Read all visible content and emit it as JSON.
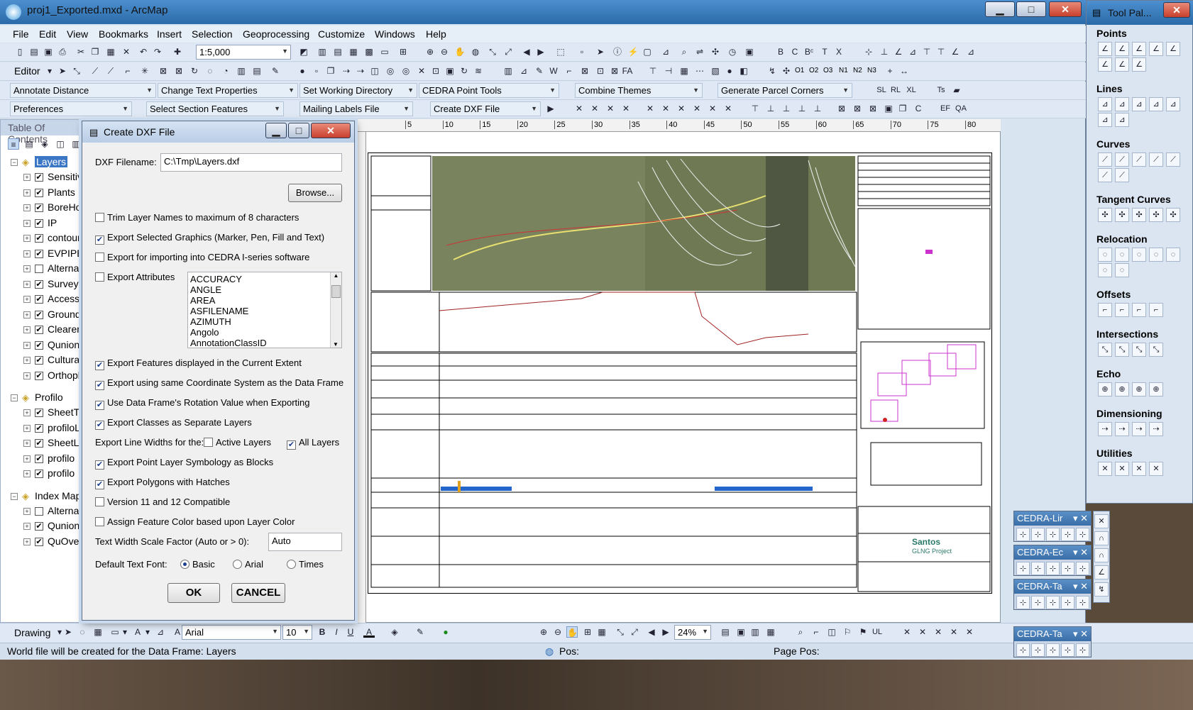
{
  "window": {
    "title": "proj1_Exported.mxd - ArcMap",
    "min": "▁",
    "max": "□",
    "close": "✕"
  },
  "menu": [
    "File",
    "Edit",
    "View",
    "Bookmarks",
    "Insert",
    "Selection",
    "Geoprocessing",
    "Customize",
    "Windows",
    "Help"
  ],
  "toolbar": {
    "scale": "1:5,000",
    "editor_label": "Editor",
    "dropdowns_row3": [
      "Annotate Distance",
      "Change Text Properties",
      "Set Working Directory",
      "CEDRA Point Tools",
      "Combine Themes",
      "Generate Parcel Corners"
    ],
    "dropdowns_row4": [
      "Preferences",
      "Select Section Features",
      "Mailing Labels File",
      "Create DXF File"
    ],
    "row2_text": [
      "O1",
      "O2",
      "O3",
      "N1",
      "N2",
      "N3"
    ]
  },
  "toc": {
    "header": "Table Of Contents",
    "groups": [
      {
        "name": "Layers",
        "layers": [
          {
            "name": "Sensitiv",
            "checked": true
          },
          {
            "name": "Plants",
            "checked": true
          },
          {
            "name": "BoreHo",
            "checked": true
          },
          {
            "name": "IP",
            "checked": true
          },
          {
            "name": "contour",
            "checked": true
          },
          {
            "name": "EVPIPET",
            "checked": true
          },
          {
            "name": "Alternat",
            "checked": false
          },
          {
            "name": "Survey",
            "checked": true
          },
          {
            "name": "Access T",
            "checked": true
          },
          {
            "name": "Ground",
            "checked": true
          },
          {
            "name": "Clearen",
            "checked": true
          },
          {
            "name": "Qunione",
            "checked": true
          },
          {
            "name": "Cultural",
            "checked": true
          },
          {
            "name": "Orthoph",
            "checked": true
          }
        ]
      },
      {
        "name": "Profilo",
        "layers": [
          {
            "name": "SheetTe",
            "checked": true
          },
          {
            "name": "profiloL",
            "checked": true
          },
          {
            "name": "SheetLi",
            "checked": true
          },
          {
            "name": "profilo",
            "checked": true
          },
          {
            "name": "profilo",
            "checked": true
          }
        ]
      },
      {
        "name": "Index Map",
        "layers": [
          {
            "name": "Alternat",
            "checked": false
          },
          {
            "name": "Quniona",
            "checked": true
          },
          {
            "name": "QuOver",
            "checked": true
          }
        ]
      }
    ]
  },
  "ruler": [
    "5",
    "10",
    "15",
    "20",
    "25",
    "30",
    "35",
    "40",
    "45",
    "50",
    "55",
    "60",
    "65",
    "70",
    "75",
    "80"
  ],
  "dialog": {
    "title": "Create DXF File",
    "filename_label": "DXF Filename:",
    "filename_value": "C:\\Tmp\\Layers.dxf",
    "browse": "Browse...",
    "options_top": [
      {
        "label": "Trim Layer Names to maximum of 8 characters",
        "checked": false
      },
      {
        "label": "Export Selected Graphics (Marker, Pen, Fill and Text)",
        "checked": true
      },
      {
        "label": "Export for importing into CEDRA I-series software",
        "checked": false
      },
      {
        "label": "Export Attributes",
        "checked": false
      }
    ],
    "attributes": [
      "ACCURACY",
      "ANGLE",
      "AREA",
      "ASFILENAME",
      "AZIMUTH",
      "Angolo",
      "AnnotationClassID"
    ],
    "options_mid": [
      {
        "label": "Export Features displayed in the Current Extent",
        "checked": true
      },
      {
        "label": "Export using same Coordinate System as the Data Frame",
        "checked": true
      },
      {
        "label": "Use Data Frame's Rotation Value when Exporting",
        "checked": true
      },
      {
        "label": "Export Classes as Separate Layers",
        "checked": true
      }
    ],
    "linewidth_label": "Export Line Widths for the:",
    "active_layers": {
      "label": "Active Layers",
      "checked": false
    },
    "all_layers": {
      "label": "All Layers",
      "checked": true
    },
    "options_bottom": [
      {
        "label": "Export Point Layer Symbology as Blocks",
        "checked": true
      },
      {
        "label": "Export Polygons with Hatches",
        "checked": true
      },
      {
        "label": "Version 11 and 12 Compatible",
        "checked": false
      },
      {
        "label": "Assign Feature Color based upon Layer Color",
        "checked": false
      }
    ],
    "textwidth_label": "Text Width Scale Factor (Auto or > 0):",
    "textwidth_value": "Auto",
    "font_label": "Default Text Font:",
    "fonts": [
      {
        "label": "Basic",
        "selected": true
      },
      {
        "label": "Arial",
        "selected": false
      },
      {
        "label": "Times",
        "selected": false
      }
    ],
    "ok": "OK",
    "cancel": "CANCEL"
  },
  "palette": {
    "title": "Tool Pal...",
    "sections": [
      "Points",
      "Lines",
      "Curves",
      "Tangent Curves",
      "Relocation",
      "Offsets",
      "Intersections",
      "Echo",
      "Dimensioning",
      "Utilities"
    ],
    "minipals": [
      "CEDRA-Lir",
      "CEDRA-Ec",
      "CEDRA-Ta",
      "CEDRA-Ta"
    ]
  },
  "drawing": {
    "label": "Drawing",
    "font": "Arial",
    "size": "10",
    "zoom": "24%"
  },
  "status": {
    "message": "World file will be created for the Data Frame: Layers",
    "pos": "Pos:",
    "page_pos": "Page Pos:"
  },
  "sheet_text": {
    "company": "Santos",
    "project": "GLNG Project"
  }
}
